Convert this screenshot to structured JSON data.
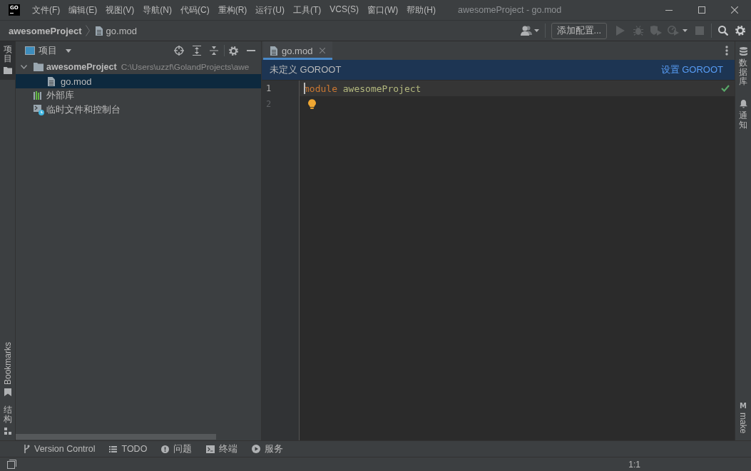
{
  "title_bar": {
    "logo": "GO",
    "menu": [
      "文件(F)",
      "编辑(E)",
      "视图(V)",
      "导航(N)",
      "代码(C)",
      "重构(R)",
      "运行(U)",
      "工具(T)",
      "VCS(S)",
      "窗口(W)",
      "帮助(H)"
    ],
    "title": "awesomeProject - go.mod"
  },
  "navigation_bar": {
    "breadcrumbs": [
      {
        "label": "awesomeProject",
        "kind": "project"
      },
      {
        "label": "go.mod",
        "kind": "file"
      }
    ],
    "run_configuration": "添加配置...",
    "run_actions": [
      {
        "kind": "run",
        "disabled": true
      },
      {
        "kind": "debug",
        "disabled": true
      },
      {
        "kind": "coverage",
        "disabled": true
      },
      {
        "kind": "profile",
        "disabled": true
      },
      {
        "kind": "stop",
        "disabled": true
      }
    ]
  },
  "left_tool_strip": {
    "top": [
      {
        "label": "项目",
        "kind": "project",
        "selected": true
      }
    ],
    "bottom": [
      {
        "label": "Bookmarks",
        "kind": "bookmarks",
        "selected": false
      },
      {
        "label": "结构",
        "kind": "structure",
        "selected": false
      }
    ]
  },
  "project_panel": {
    "title": "项目",
    "tree": [
      {
        "label": "awesomeProject",
        "path": "C:\\Users\\uzzf\\GolandProjects\\awe",
        "kind": "module",
        "expanded": true,
        "selected": false,
        "children": [
          {
            "label": "go.mod",
            "kind": "file",
            "selected": true
          }
        ]
      },
      {
        "label": "外部库",
        "kind": "libraries",
        "selected": false
      },
      {
        "label": "临时文件和控制台",
        "kind": "scratches",
        "selected": false
      }
    ]
  },
  "editor": {
    "tabs": [
      {
        "label": "go.mod",
        "selected": true
      }
    ],
    "banner": {
      "message": "未定义 GOROOT",
      "action": "设置 GOROOT"
    },
    "lines": [
      {
        "number": "1",
        "current": true,
        "caret": true,
        "intention_bulb": false,
        "tokens": [
          {
            "text": "module",
            "kind": "keyword"
          },
          {
            "text": "awesomeProject",
            "kind": "identifier"
          }
        ]
      },
      {
        "number": "2",
        "current": false,
        "caret": false,
        "intention_bulb": true
      }
    ]
  },
  "right_tool_strip": {
    "top": [
      {
        "label": "数据库",
        "kind": "database",
        "selected": false
      },
      {
        "label": "通知",
        "kind": "notifications",
        "selected": false
      }
    ],
    "bottom": [
      {
        "label": "make",
        "kind": "make",
        "glyph": "M",
        "selected": false
      }
    ]
  },
  "bottom_tool_bar": [
    {
      "label": "Version Control",
      "kind": "vcs"
    },
    {
      "label": "TODO",
      "kind": "todo"
    },
    {
      "label": "问题",
      "kind": "problems"
    },
    {
      "label": "终端",
      "kind": "terminal"
    },
    {
      "label": "服务",
      "kind": "services"
    }
  ],
  "status_bar": {
    "position": "1:1"
  }
}
